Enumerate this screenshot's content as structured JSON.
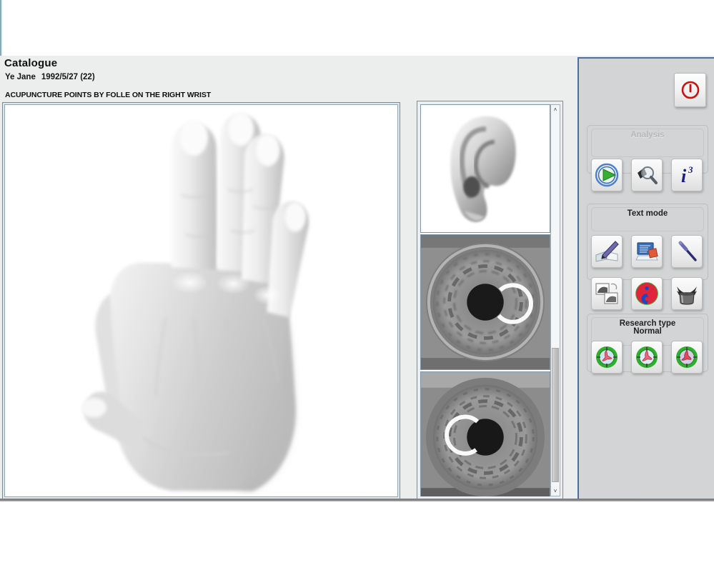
{
  "header": {
    "catalogue_title": "Catalogue",
    "patient_name": "Ye  Jane",
    "patient_date": "1992/5/27 (22)",
    "section_title": "ACUPUNCTURE POINTS BY FOLLE ON THE RIGHT WRIST"
  },
  "main_image": {
    "name": "right-hand-dorsum-grayscale",
    "alt": "Grayscale photograph of the back of a right hand"
  },
  "thumbnails": [
    {
      "name": "ear-thumbnail",
      "alt": "Grayscale photograph of an ear"
    },
    {
      "name": "iris-thumbnail-1",
      "alt": "Grayscale close-up of an iris"
    },
    {
      "name": "iris-thumbnail-2",
      "alt": "Grayscale close-up of an iris"
    }
  ],
  "scrollbar": {
    "up_arrow": "˄",
    "down_arrow": "˅"
  },
  "sidebar": {
    "power_button": {
      "label": "power-off",
      "color": "#cc1111"
    },
    "groups": [
      {
        "key": "analysis",
        "label": "Analysis",
        "disabled": true,
        "buttons": [
          {
            "name": "run-analysis-button",
            "icon": "green-play-icon"
          },
          {
            "name": "magnifier-button",
            "icon": "magnifier-icon"
          },
          {
            "name": "info-button",
            "icon": "i-cubed-icon",
            "glyph": "i"
          }
        ]
      },
      {
        "key": "text_mode",
        "label": "Text mode",
        "disabled": false,
        "buttons": [
          {
            "name": "notes-button",
            "icon": "book-and-pen-icon"
          },
          {
            "name": "report-button",
            "icon": "screen-and-cards-icon"
          },
          {
            "name": "needle-button",
            "icon": "acupuncture-needle-icon"
          },
          {
            "name": "images-button",
            "icon": "photo-stack-icon"
          },
          {
            "name": "yin-yang-button",
            "icon": "yin-yang-icon"
          },
          {
            "name": "cupping-button",
            "icon": "cupping-jar-icon"
          }
        ]
      },
      {
        "key": "research_type",
        "label": "Research type",
        "sublabel": "Normal",
        "disabled": false,
        "buttons": [
          {
            "name": "research-type-1-button",
            "icon": "anatomy-dial-blue-icon"
          },
          {
            "name": "research-type-2-button",
            "icon": "anatomy-dial-lightblue-icon"
          },
          {
            "name": "research-type-3-button",
            "icon": "anatomy-dial-violet-icon"
          }
        ]
      }
    ]
  },
  "colors": {
    "sidebar_bg": "#d2d4d5",
    "window_bg": "#eceeee",
    "panel_border": "#6e8ea4",
    "sidebar_border": "#4f6f94",
    "power_red": "#cc1111",
    "accent_green": "#2fae2f"
  }
}
